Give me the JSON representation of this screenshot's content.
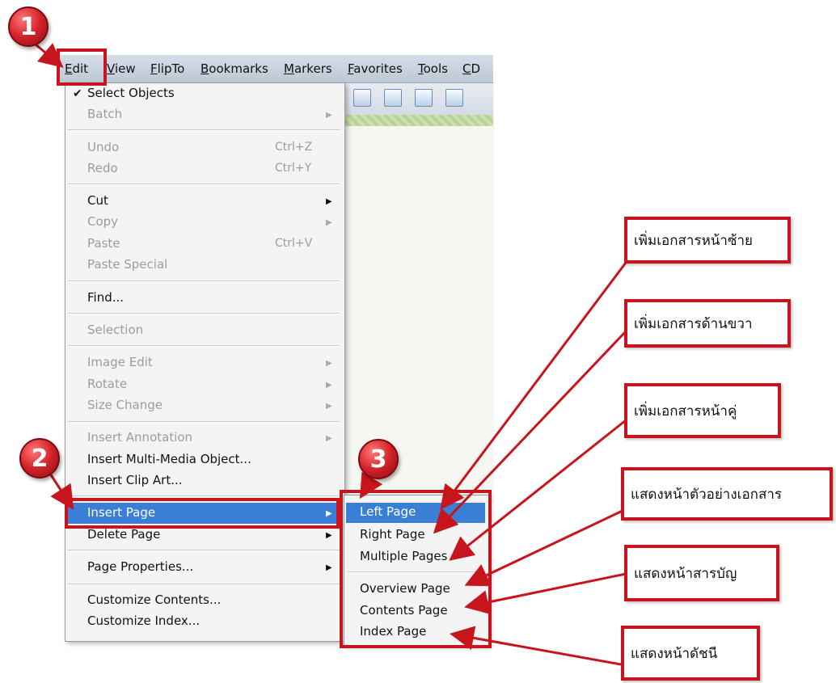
{
  "menubar": {
    "items": [
      "Edit",
      "View",
      "FlipTo",
      "Bookmarks",
      "Markers",
      "Favorites",
      "Tools",
      "CD"
    ]
  },
  "edit_menu": {
    "select_objects": "Select Objects",
    "batch": "Batch",
    "undo": "Undo",
    "undo_shortcut": "Ctrl+Z",
    "redo": "Redo",
    "redo_shortcut": "Ctrl+Y",
    "cut": "Cut",
    "copy": "Copy",
    "paste": "Paste",
    "paste_shortcut": "Ctrl+V",
    "paste_special": "Paste Special",
    "find": "Find...",
    "selection": "Selection",
    "image_edit": "Image Edit",
    "rotate": "Rotate",
    "size_change": "Size Change",
    "insert_annotation": "Insert Annotation",
    "insert_multimedia": "Insert Multi-Media Object...",
    "insert_clip_art": "Insert Clip Art...",
    "insert_page": "Insert Page",
    "delete_page": "Delete Page",
    "page_properties": "Page Properties...",
    "customize_contents": "Customize Contents...",
    "customize_index": "Customize Index..."
  },
  "insert_page_submenu": {
    "left_page": "Left Page",
    "right_page": "Right Page",
    "multiple_pages": "Multiple Pages",
    "overview_page": "Overview Page",
    "contents_page": "Contents Page",
    "index_page": "Index Page"
  },
  "steps": [
    "1",
    "2",
    "3"
  ],
  "callouts": {
    "left_page": "เพิ่มเอกสารหน้าซ้าย",
    "right_page": "เพิ่มเอกสารด้านขวา",
    "multiple_pages": "เพิ่มเอกสารหน้าคู่",
    "overview_page": "แสดงหน้าตัวอย่างเอกสาร",
    "contents_page": "แสดงหน้าสารบัญ",
    "index_page": "แสดงหน้าดัชนี"
  },
  "colors": {
    "annotation_red": "#c8141c",
    "highlight_blue": "#3a7fd5"
  }
}
